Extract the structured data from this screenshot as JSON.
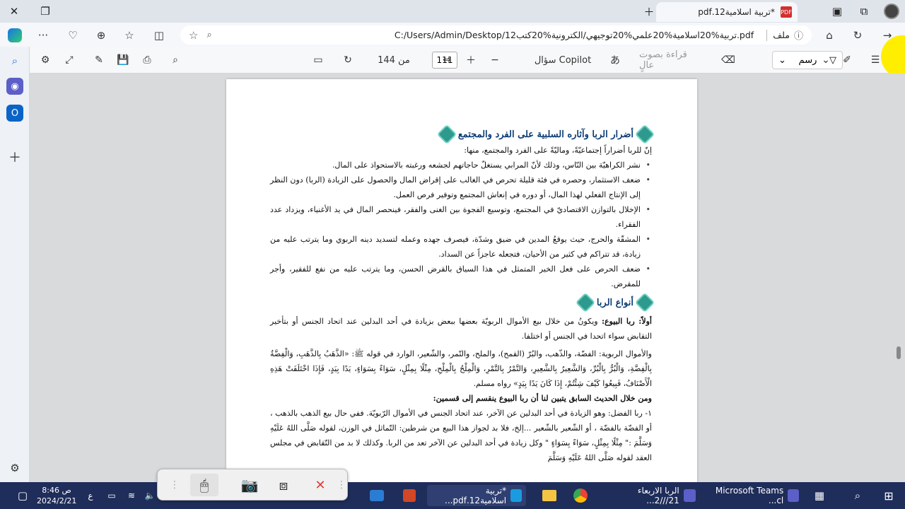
{
  "window": {
    "tab_title": "*تربية اسلامية12.pdf",
    "pdf_badge": "PDF"
  },
  "address": {
    "url": "C:/Users/Admin/Desktop/12تربية%20اسلامية%20علمي%20توجيهي/الكترونية%20كتب.pdf",
    "file_label": "ملف"
  },
  "toolbar": {
    "draw_label": "رسم",
    "read_aloud_label": "قراءة بصوت عالٍ",
    "copilot_label": "سؤال Copilot",
    "page_current": "111",
    "page_total_label": "من 144"
  },
  "document": {
    "heading1": "أضرار الربا وآثاره السلبية على الفرد والمجتمع",
    "intro": "إنّ للربا أضراراً إجتماعيّةً، وماليّةً على الفرد والمجتمع، منها:",
    "bullets": [
      "نشر الكراهيّة بين النّاس، وذلك لأنّ المرابي يستغلّ حاجاتهم لجشعه ورغبته بالاستحواذ على المال.",
      "ضعف الاستثمار، وحصره في فئة قليلة تحرص في الغالب على إقراض المال والحصول على الزيادة (الربا) دون النظر إلى الإنتاج الفعلي لهذا المال، أو دوره في إنعاش المجتمع وتوفير فرص العمل.",
      "الإخلال بالتوازن الاقتصاديّ في المجتمع، وتوسيع الفجوة بين الغنى والفقر، فينحصر المال في يد الأغنياء، ويزداد عدد الفقراء.",
      "المشقّة والحرج، حيث يوقعُ المدين في ضيق وشدّة، فيصرف جهده وعمله لتسديد دينه الربوي وما يترتب عليه من زيادة، قد تتراكم في كثير من الأحيان، فتجعله عاجزاً عن السداد.",
      "ضعف الحرص على فعل الخير المتمثل في هذا السياق بالقرض الحسن، وما يترتب عليه من نفع للفقير، وأجر للمقرض."
    ],
    "heading2": "أنواع الربا",
    "first_label": "أولاً: ربا البيوع:",
    "first_text": "ويكونُ من خلال بيع الأموال الربويّة بعضها ببعض بزيادة في أحد البدلين عند اتحاد الجنس أو بتأخير التقابض سواء اتحدا في الجنس أو اختلفا.",
    "riba_items": "والأموال الربوية: الفضّة، والذّهب، والبُرّ (القمح)، والملح، والتّمر، والشّعير، الوارد في قوله ﷺ: «الذَّهَبُ بِالذَّهَبِ، وَالْفِضَّةُ بِالْفِضَّةِ، وَالْبُرُّ بِالْبُرِّ، وَالشَّعِيرُ بِالشَّعِيرِ، وَالتَّمْرُ بِالتَّمْرِ، وَالْمِلْحُ بِالْمِلْحِ، مِثْلًا بِمِثْلٍ، سَوَاءً بِسَوَاءٍ، يَدًا بِيَدٍ، فَإِذَا اخْتَلَفَتْ هَذِهِ الْأَصْنَافُ، فَبِيعُوا كَيْفَ شِئْتُمْ، إِذَا كَانَ يَدًا بِيَدٍ» رواه مسلم.",
    "hadith_conclusion": "ومن خلال الحديث السابق يتبين لنا أن ربا البيوع ينقسم إلى قسمين:",
    "fadl": "١- ربا الفضل: وهو الزيادة في أحد البدلين عن الآخر، عند اتحاد الجنس في الأموال الرّبويّة. ففي حال بيع الذهب بالذهب ، أو الفضّة بالفضّة ، أو الشّعير بالشّعير ...إلخ، فلا بد لجواز هذا البيع من شرطين: التّماثل في الوزن، لقوله صَلَّى اللهُ عَلَيْهِ وَسَلَّمَ :\" مِثْلًا بِمِثْلٍ، سَوَاءً بِسَوَاءٍ \" وكل زيادة في أحد البدلين عن الآخر تعد من الربا. وكذلك لا بد من التّقابض في مجلس العقد لقوله صَلَّى اللهُ عَلَيْهِ وَسَلَّمَ"
  },
  "taskbar": {
    "time": "8:46 ص",
    "date": "2024/2/21",
    "lang": "ع",
    "teams_label": "Microsoft Teams cl...",
    "item2_label": "الربا الاربعاء 21///2...",
    "item3_label": "*تربية اسلامية12.pdf..."
  },
  "colors": {
    "heading": "#0d3d75",
    "ornament": "#2e9a8e",
    "taskbar": "#1f2d5a",
    "highlight": "#ffee00"
  }
}
